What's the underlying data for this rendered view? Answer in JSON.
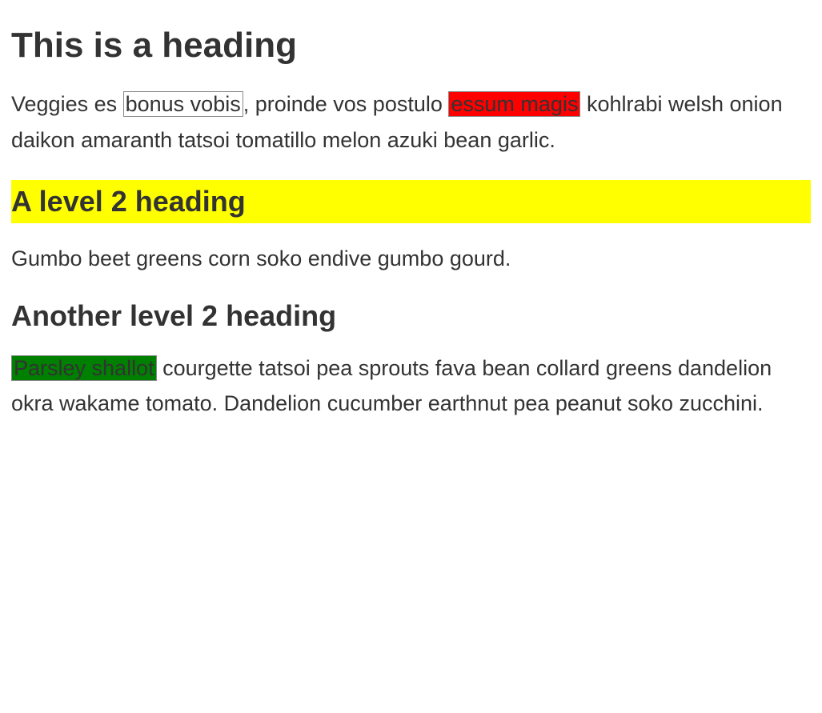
{
  "heading1": "This is a heading",
  "para1": {
    "t1": "Veggies es ",
    "boxed": "bonus vobis",
    "t2": ", proinde vos postulo ",
    "red": "essum magis",
    "t3": " kohlrabi welsh onion daikon amaranth tatsoi tomatillo melon azuki bean garlic."
  },
  "heading2a": "A level 2 heading",
  "para2": "Gumbo beet greens corn soko endive gumbo gourd.",
  "heading2b": "Another level 2 heading",
  "para3": {
    "green": "Parsley shallot",
    "rest": " courgette tatsoi pea sprouts fava bean collard greens dandelion okra wakame tomato. Dandelion cucumber earthnut pea peanut soko zucchini."
  }
}
